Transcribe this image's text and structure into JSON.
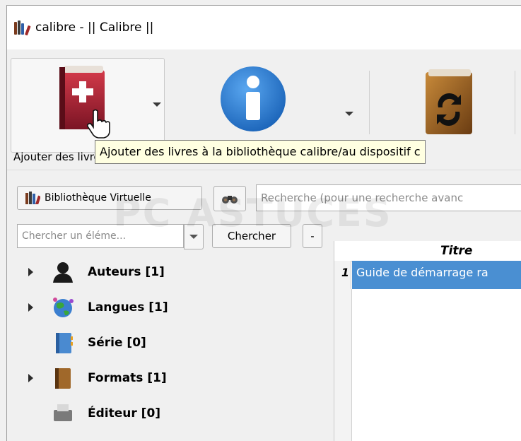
{
  "window": {
    "title": "calibre - || Calibre ||"
  },
  "toolbar": {
    "add_books_label": "Ajouter des livres",
    "tooltip": "Ajouter des livres à la bibliothèque calibre/au dispositif c"
  },
  "search_bar": {
    "virtual_library_label": "Bibliothèque Virtuelle",
    "search_placeholder": "Recherche (pour une recherche avanc"
  },
  "tag_browser": {
    "find_placeholder": "Chercher un éléme...",
    "find_button": "Chercher",
    "collapse_button": "-",
    "items": [
      {
        "label": "Auteurs [1]",
        "expandable": true,
        "icon": "person-icon"
      },
      {
        "label": "Langues [1]",
        "expandable": true,
        "icon": "globe-icon"
      },
      {
        "label": "Série [0]",
        "expandable": false,
        "icon": "notebook-icon"
      },
      {
        "label": "Formats [1]",
        "expandable": true,
        "icon": "book-icon"
      },
      {
        "label": "Éditeur [0]",
        "expandable": false,
        "icon": "printer-icon"
      }
    ]
  },
  "book_list": {
    "columns": [
      "Titre"
    ],
    "rows": [
      {
        "num": "1",
        "title": "Guide de démarrage ra"
      }
    ]
  },
  "watermark": "PC ASTUCES",
  "colors": {
    "selection": "#4a8fd2",
    "tooltip_bg": "#ffffe1"
  }
}
